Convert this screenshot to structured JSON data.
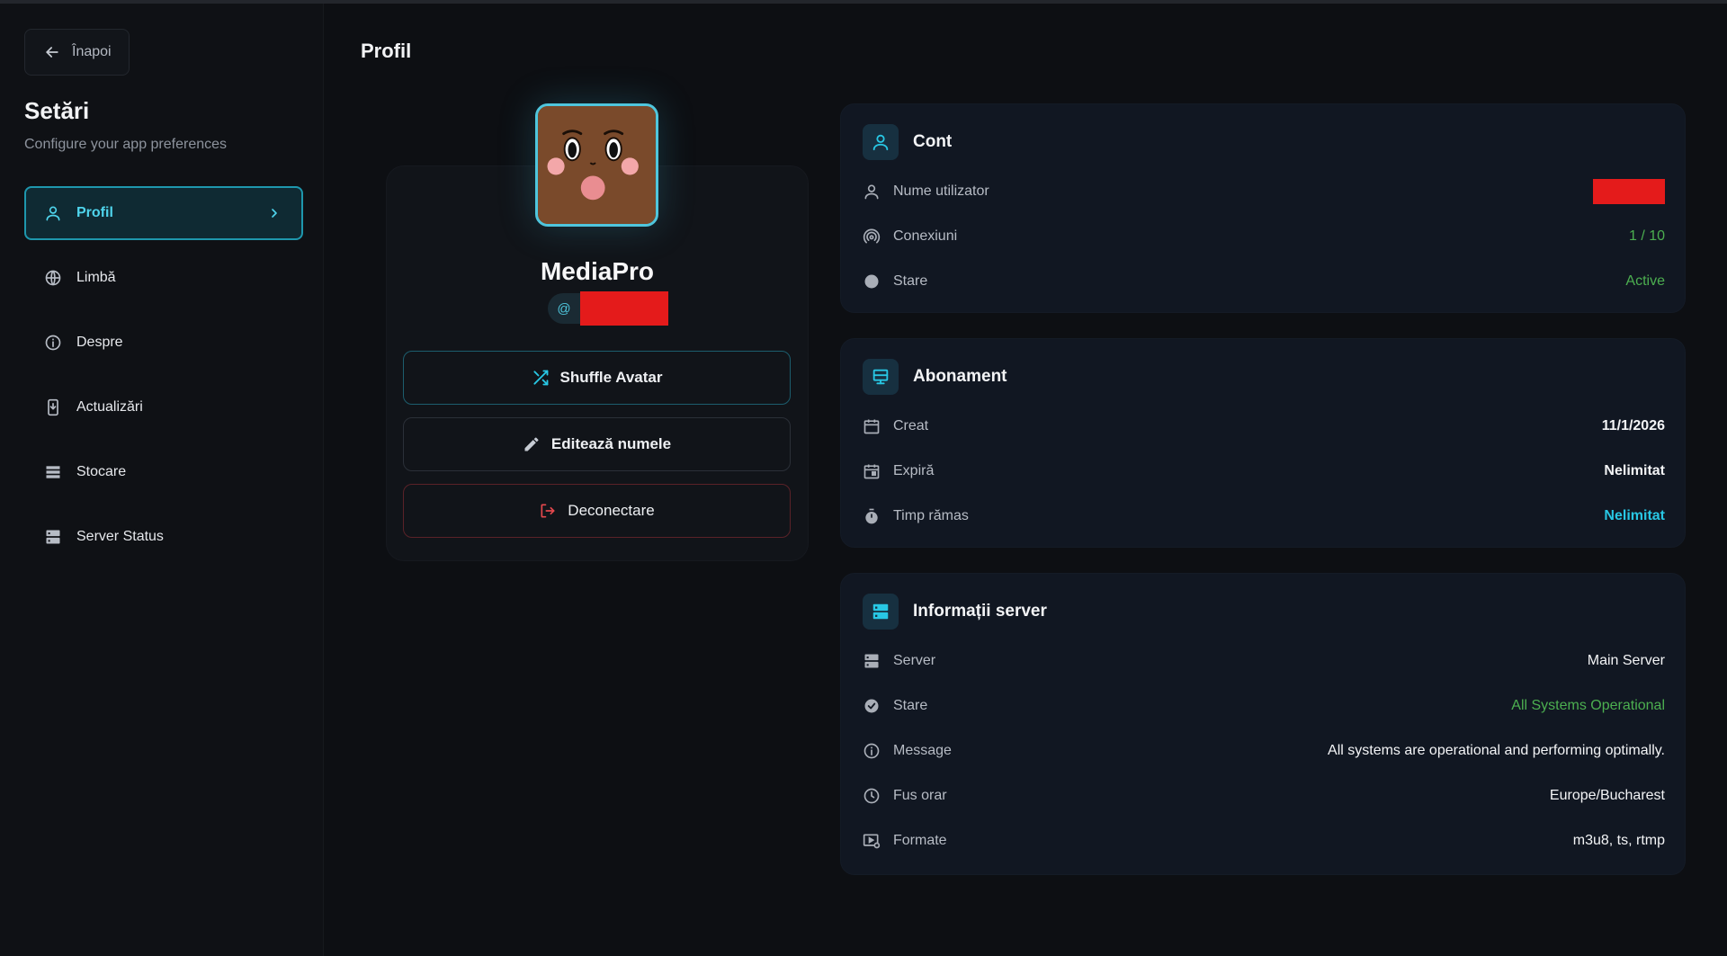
{
  "sidebar": {
    "back_label": "Înapoi",
    "title": "Setări",
    "subtitle": "Configure your app preferences",
    "items": [
      {
        "label": "Profil",
        "icon": "user-icon",
        "active": true
      },
      {
        "label": "Limbă",
        "icon": "globe-icon"
      },
      {
        "label": "Despre",
        "icon": "info-icon"
      },
      {
        "label": "Actualizări",
        "icon": "download-icon"
      },
      {
        "label": "Stocare",
        "icon": "storage-icon"
      },
      {
        "label": "Server Status",
        "icon": "server-icon"
      }
    ]
  },
  "page": {
    "title": "Profil"
  },
  "profile": {
    "name": "MediaPro",
    "handle_prefix": "@",
    "buttons": {
      "shuffle": "Shuffle Avatar",
      "edit": "Editează numele",
      "logout": "Deconectare"
    }
  },
  "account": {
    "title": "Cont",
    "rows": [
      {
        "label": "Nume utilizator",
        "value": ""
      },
      {
        "label": "Conexiuni",
        "value": "1 / 10"
      },
      {
        "label": "Stare",
        "value": "Active"
      }
    ]
  },
  "subscription": {
    "title": "Abonament",
    "rows": [
      {
        "label": "Creat",
        "value": "11/1/2026"
      },
      {
        "label": "Expiră",
        "value": "Nelimitat"
      },
      {
        "label": "Timp rămas",
        "value": "Nelimitat"
      }
    ]
  },
  "server": {
    "title": "Informații server",
    "rows": [
      {
        "label": "Server",
        "value": "Main Server"
      },
      {
        "label": "Stare",
        "value": "All Systems Operational"
      },
      {
        "label": "Message",
        "value": "All systems are operational and performing optimally."
      },
      {
        "label": "Fus orar",
        "value": "Europe/Bucharest"
      },
      {
        "label": "Formate",
        "value": "m3u8, ts, rtmp"
      }
    ]
  },
  "colors": {
    "accent": "#28c7e4",
    "success": "#4caf50",
    "danger": "#e5484d",
    "background": "#0d0f13"
  }
}
